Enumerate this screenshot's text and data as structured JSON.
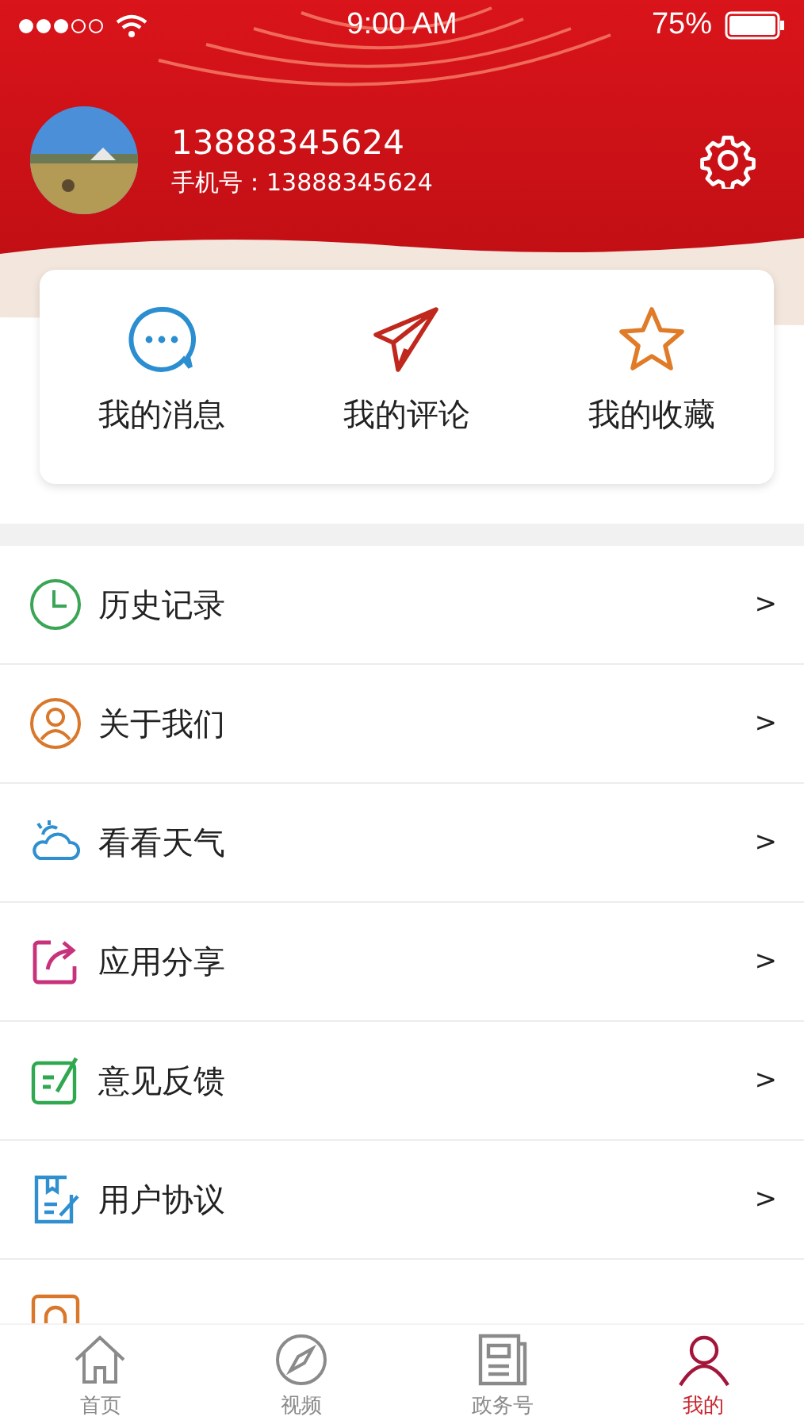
{
  "status_bar": {
    "time": "9:00 AM",
    "battery": "75%"
  },
  "profile": {
    "name": "13888345624",
    "phone": "手机号：13888345624"
  },
  "shortcuts": [
    {
      "label": "我的消息"
    },
    {
      "label": "我的评论"
    },
    {
      "label": "我的收藏"
    }
  ],
  "menu": [
    {
      "label": "历史记录",
      "arrow": ">"
    },
    {
      "label": "关于我们",
      "arrow": ">"
    },
    {
      "label": "看看天气",
      "arrow": ">"
    },
    {
      "label": "应用分享",
      "arrow": ">"
    },
    {
      "label": "意见反馈",
      "arrow": ">"
    },
    {
      "label": "用户协议",
      "arrow": ">"
    }
  ],
  "tab_bar": [
    {
      "label": "首页",
      "selected": false
    },
    {
      "label": "视频",
      "selected": false
    },
    {
      "label": "政务号",
      "selected": false
    },
    {
      "label": "我的",
      "selected": true
    }
  ]
}
